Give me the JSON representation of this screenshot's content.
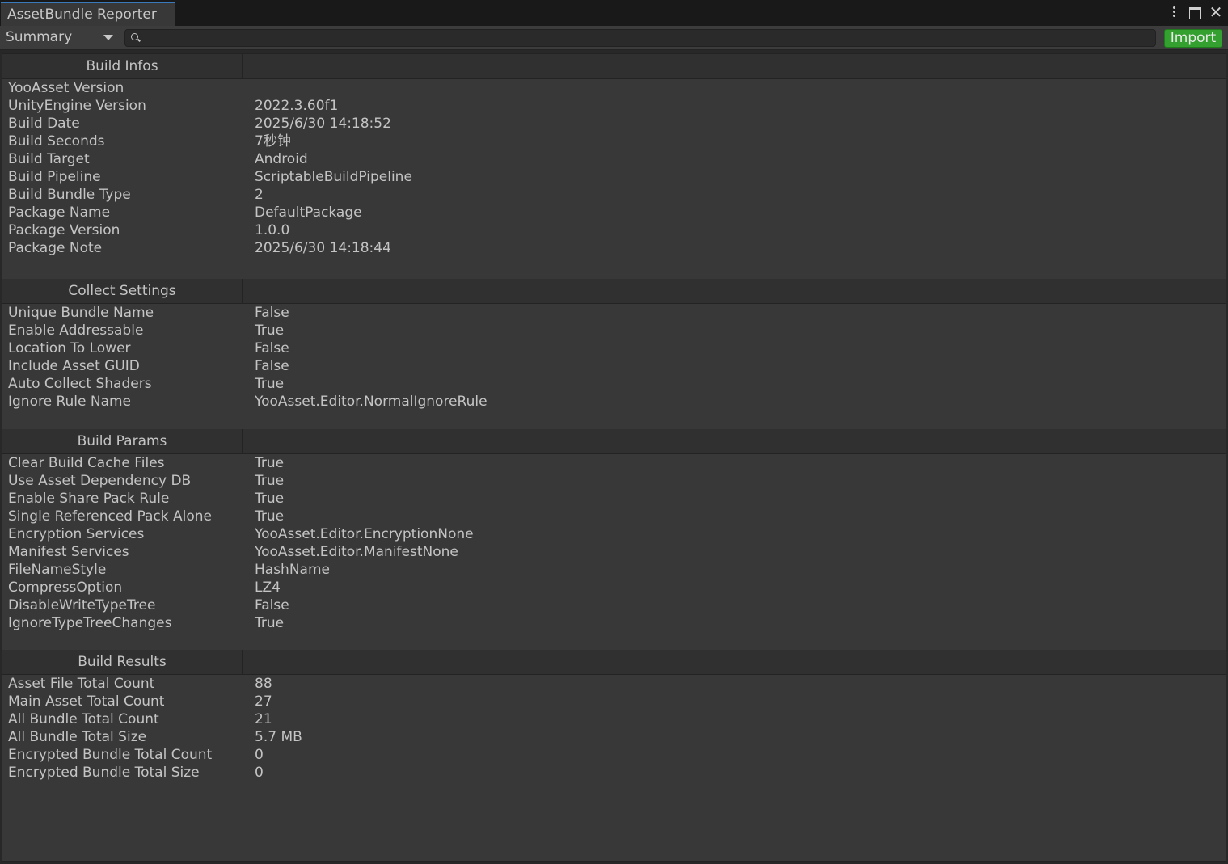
{
  "window": {
    "tab_title": "AssetBundle Reporter"
  },
  "toolbar": {
    "view_selected": "Summary",
    "search_value": "",
    "import_label": "Import"
  },
  "sections": [
    {
      "title": "Build Infos",
      "rows": [
        {
          "key": "YooAsset Version",
          "value": ""
        },
        {
          "key": "UnityEngine Version",
          "value": "2022.3.60f1"
        },
        {
          "key": "Build Date",
          "value": "2025/6/30 14:18:52"
        },
        {
          "key": "Build Seconds",
          "value": "7秒钟"
        },
        {
          "key": "Build Target",
          "value": "Android"
        },
        {
          "key": "Build Pipeline",
          "value": "ScriptableBuildPipeline"
        },
        {
          "key": "Build Bundle Type",
          "value": "2"
        },
        {
          "key": "Package Name",
          "value": "DefaultPackage"
        },
        {
          "key": "Package Version",
          "value": "1.0.0"
        },
        {
          "key": "Package Note",
          "value": "2025/6/30 14:18:44"
        }
      ]
    },
    {
      "title": "Collect Settings",
      "rows": [
        {
          "key": "Unique Bundle Name",
          "value": "False"
        },
        {
          "key": "Enable Addressable",
          "value": "True"
        },
        {
          "key": "Location To Lower",
          "value": "False"
        },
        {
          "key": "Include Asset GUID",
          "value": "False"
        },
        {
          "key": "Auto Collect Shaders",
          "value": "True"
        },
        {
          "key": "Ignore Rule Name",
          "value": "YooAsset.Editor.NormalIgnoreRule"
        }
      ]
    },
    {
      "title": "Build Params",
      "rows": [
        {
          "key": "Clear Build Cache Files",
          "value": "True"
        },
        {
          "key": "Use Asset Dependency DB",
          "value": "True"
        },
        {
          "key": "Enable Share Pack Rule",
          "value": "True"
        },
        {
          "key": "Single Referenced Pack Alone",
          "value": "True"
        },
        {
          "key": "Encryption Services",
          "value": "YooAsset.Editor.EncryptionNone"
        },
        {
          "key": "Manifest Services",
          "value": "YooAsset.Editor.ManifestNone"
        },
        {
          "key": "FileNameStyle",
          "value": "HashName"
        },
        {
          "key": "CompressOption",
          "value": "LZ4"
        },
        {
          "key": "DisableWriteTypeTree",
          "value": "False"
        },
        {
          "key": "IgnoreTypeTreeChanges",
          "value": "True"
        }
      ]
    },
    {
      "title": "Build Results",
      "rows": [
        {
          "key": "Asset File Total Count",
          "value": "88"
        },
        {
          "key": "Main Asset Total Count",
          "value": "27"
        },
        {
          "key": "All Bundle Total Count",
          "value": "21"
        },
        {
          "key": "All Bundle Total Size",
          "value": "5.7 MB"
        },
        {
          "key": "Encrypted Bundle Total Count",
          "value": "0"
        },
        {
          "key": "Encrypted Bundle Total Size",
          "value": "0"
        }
      ]
    }
  ]
}
